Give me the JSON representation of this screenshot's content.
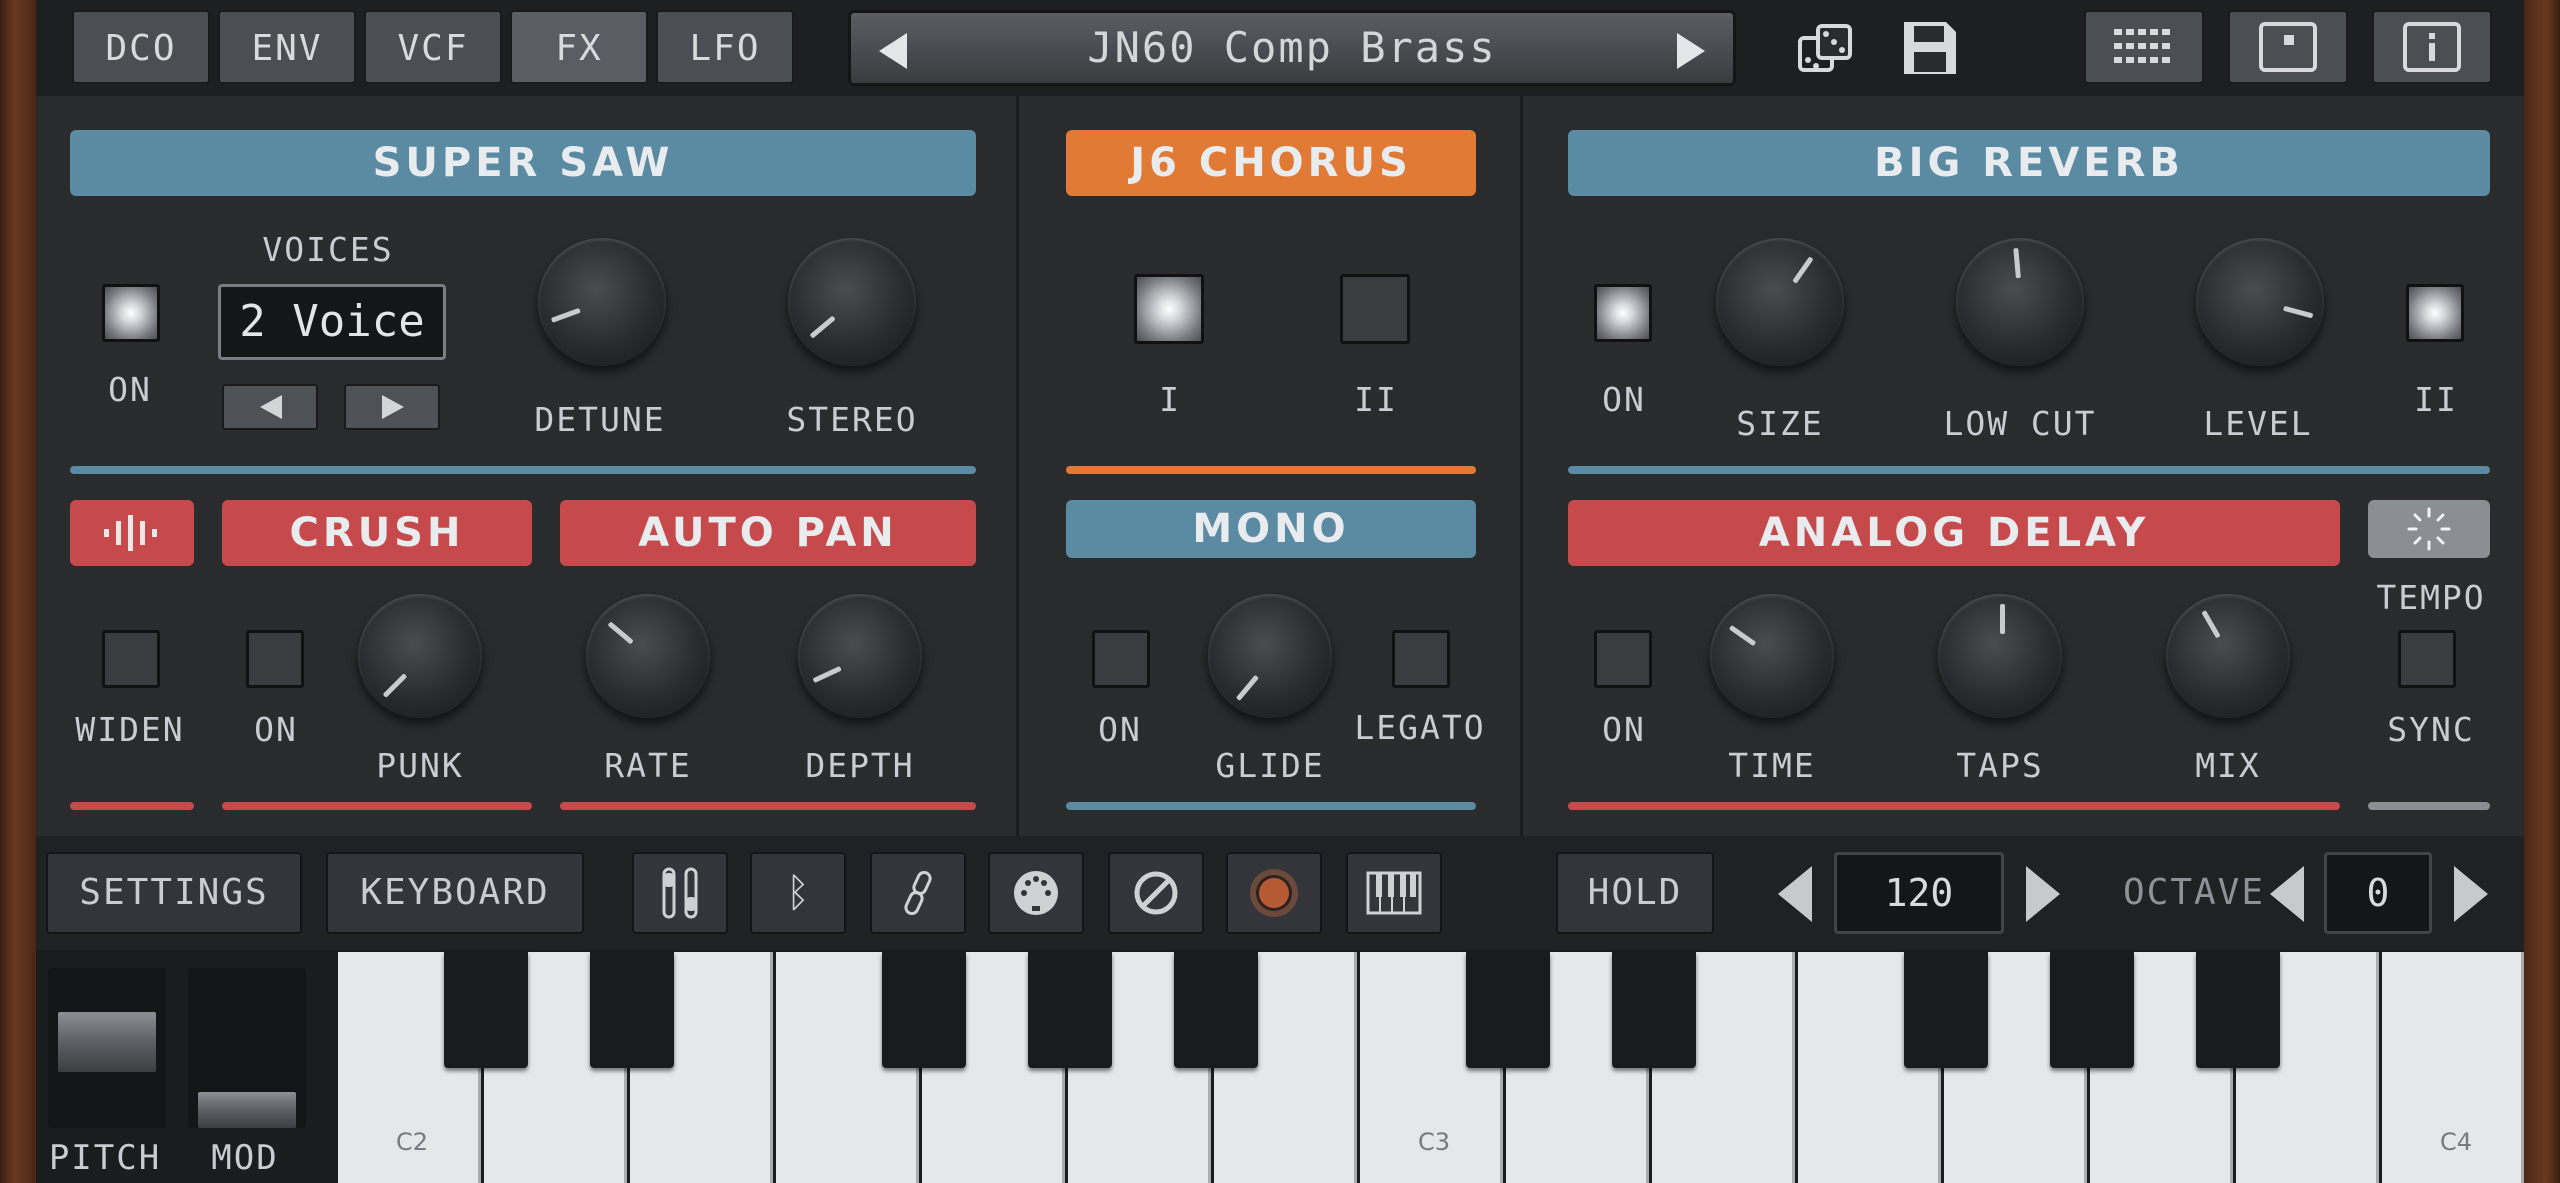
{
  "tabs": [
    "DCO",
    "ENV",
    "VCF",
    "FX",
    "LFO"
  ],
  "active_tab": "FX",
  "preset": {
    "name": "JN60 Comp Brass"
  },
  "top_icons": [
    "dice-icon",
    "save-icon",
    "grid-icon",
    "window-icon",
    "info-icon"
  ],
  "super_saw": {
    "title": "SUPER SAW",
    "voices_label": "VOICES",
    "voices_value": "2 Voice",
    "on_label": "ON",
    "detune_label": "DETUNE",
    "stereo_label": "STEREO"
  },
  "chorus": {
    "title": "J6 CHORUS",
    "i_label": "I",
    "ii_label": "II"
  },
  "reverb": {
    "title": "BIG REVERB",
    "on_label": "ON",
    "size_label": "SIZE",
    "lowcut_label": "LOW CUT",
    "level_label": "LEVEL",
    "ii_label": "II"
  },
  "widen": {
    "label": "WIDEN"
  },
  "crush": {
    "title": "CRUSH",
    "on_label": "ON",
    "punk_label": "PUNK"
  },
  "autopan": {
    "title": "AUTO PAN",
    "rate_label": "RATE",
    "depth_label": "DEPTH"
  },
  "mono": {
    "title": "MONO",
    "on_label": "ON",
    "glide_label": "GLIDE",
    "legato_label": "LEGATO"
  },
  "delay": {
    "title": "ANALOG DELAY",
    "on_label": "ON",
    "time_label": "TIME",
    "taps_label": "TAPS",
    "mix_label": "MIX",
    "tempo_label": "TEMPO",
    "sync_label": "SYNC"
  },
  "controls": {
    "settings": "SETTINGS",
    "keyboard": "KEYBOARD",
    "hold": "HOLD",
    "tempo_value": "120",
    "octave_label": "OCTAVE",
    "octave_value": "0"
  },
  "wheels": {
    "pitch": "PITCH",
    "mod": "MOD"
  },
  "keys": {
    "c2": "C2",
    "c3": "C3",
    "c4": "C4"
  },
  "colors": {
    "blue": "#5b8aa3",
    "orange": "#e07a34",
    "red": "#c64a4c"
  }
}
